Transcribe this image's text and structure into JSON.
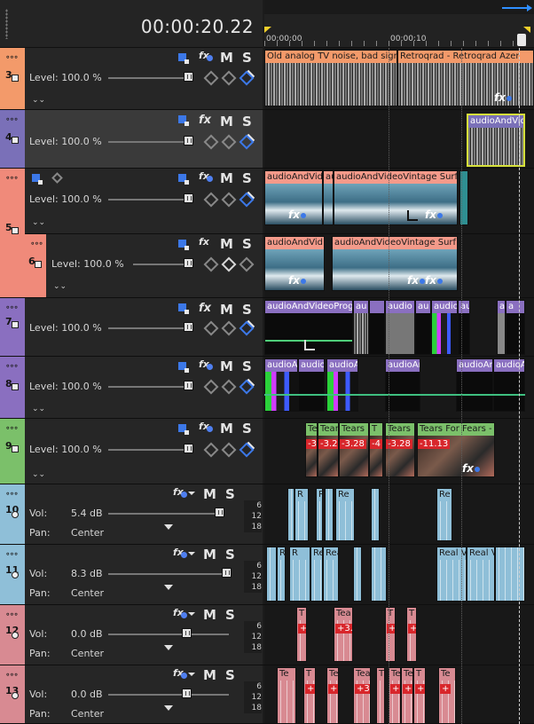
{
  "header": {
    "timecode": "00:00:20.22",
    "ruler_labels": [
      "00:00:00",
      "00:00:10"
    ]
  },
  "colors": {
    "accent_blue": "#3c78e8",
    "marker_yellow": "#f3d02a",
    "video_clip": "#f49a8a",
    "audio_clip_blue": "#8fbfd8",
    "audio_clip_red": "#d88a92"
  },
  "tracks": [
    {
      "number": "3",
      "color": "#f39a6a",
      "level_label": "Level: 100.0 %",
      "clips": [
        "Old analog TV noise, bad signal",
        "Retroqrad - Retroqrad Azer"
      ]
    },
    {
      "number": "4",
      "color": "#7a70b8",
      "level_label": "Level: 100.0 %",
      "clips": [
        "audioAndVid"
      ]
    },
    {
      "number": "5",
      "color": "#f08a7a",
      "level_label": "Level: 100.0 %",
      "clips": [
        "audioAndVid",
        "au",
        "audioAndVideoVintage Surf"
      ]
    },
    {
      "number": "6",
      "color": "#f08a7a",
      "level_label": "Level: 100.0 %",
      "clips": [
        "audioAndVid",
        "audioAndVideoVintage Surf"
      ]
    },
    {
      "number": "7",
      "color": "#8a6fc0",
      "level_label": "Level: 100.0 %",
      "clips": [
        "audioAndVideoProgr",
        "au",
        "audio",
        "au",
        "audio",
        "au",
        "a",
        "a"
      ]
    },
    {
      "number": "8",
      "color": "#8a6fc0",
      "level_label": "Level: 100.0 %",
      "clips": [
        "audioA",
        "audio",
        "audioA",
        "audioAn",
        "audioAn",
        "audioA"
      ]
    },
    {
      "number": "9",
      "color": "#7bc06a",
      "level_label": "Level: 100.0 %",
      "clips": [
        "Te",
        "Tear",
        "Tears",
        "T",
        "Tears",
        "Tears For Fears -"
      ],
      "badges": [
        "-3",
        "-3.2",
        "-3.28",
        "-4",
        "-3.28",
        "-11.13"
      ]
    },
    {
      "number": "10",
      "color": "#8fbfd8",
      "vol_label": "Vol:",
      "vol": "5.4 dB",
      "pan_label": "Pan:",
      "pan": "Center",
      "clips": [
        "R",
        "R",
        "Re",
        "Re"
      ]
    },
    {
      "number": "11",
      "color": "#8fbfd8",
      "vol_label": "Vol:",
      "vol": "8.3 dB",
      "pan_label": "Pan:",
      "pan": "Center",
      "clips": [
        "R",
        "R",
        "Re",
        "Rea",
        "Real V",
        "Real Vi",
        "Re"
      ]
    },
    {
      "number": "12",
      "color": "#d88a92",
      "vol_label": "Vol:",
      "vol": "0.0 dB",
      "pan_label": "Pan:",
      "pan": "Center",
      "clips": [
        "T",
        "Tea",
        "T",
        "T"
      ],
      "badges": [
        "+",
        "+3.",
        "+",
        "+"
      ]
    },
    {
      "number": "13",
      "color": "#d88a92",
      "vol_label": "Vol:",
      "vol": "0.0 dB",
      "pan_label": "Pan:",
      "pan": "Center",
      "clips": [
        "Te",
        "T",
        "Te",
        "Tea",
        "T",
        "Te",
        "Te",
        "T",
        "Te"
      ],
      "badges": [
        "+",
        "+",
        "+3",
        "+",
        "+",
        "+",
        "+"
      ]
    }
  ],
  "buttons": {
    "fx": "fx",
    "mute": "M",
    "solo": "S"
  },
  "meter_scale": [
    "6",
    "12",
    "18"
  ],
  "dots": "∘∘∘",
  "chevron": "⌄⌄"
}
